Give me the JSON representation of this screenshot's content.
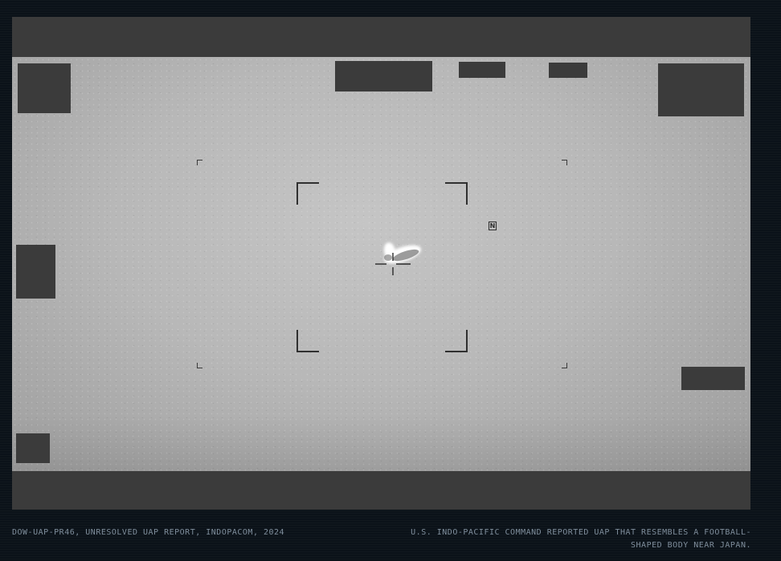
{
  "viewer": {
    "north_marker": "N"
  },
  "captions": {
    "left": "DOW-UAP-PR46, UNRESOLVED UAP REPORT, INDOPACOM, 2024",
    "right": "U.S. INDO-PACIFIC COMMAND REPORTED UAP THAT RESEMBLES A FOOTBALL-\nSHAPED BODY NEAR JAPAN."
  },
  "icons": {
    "north": "north-indicator-icon",
    "reticle": "crosshair-icon"
  },
  "colors": {
    "background": "#0b1219",
    "redaction": "#3b3b3b",
    "caption_text": "#7f8e9c"
  }
}
